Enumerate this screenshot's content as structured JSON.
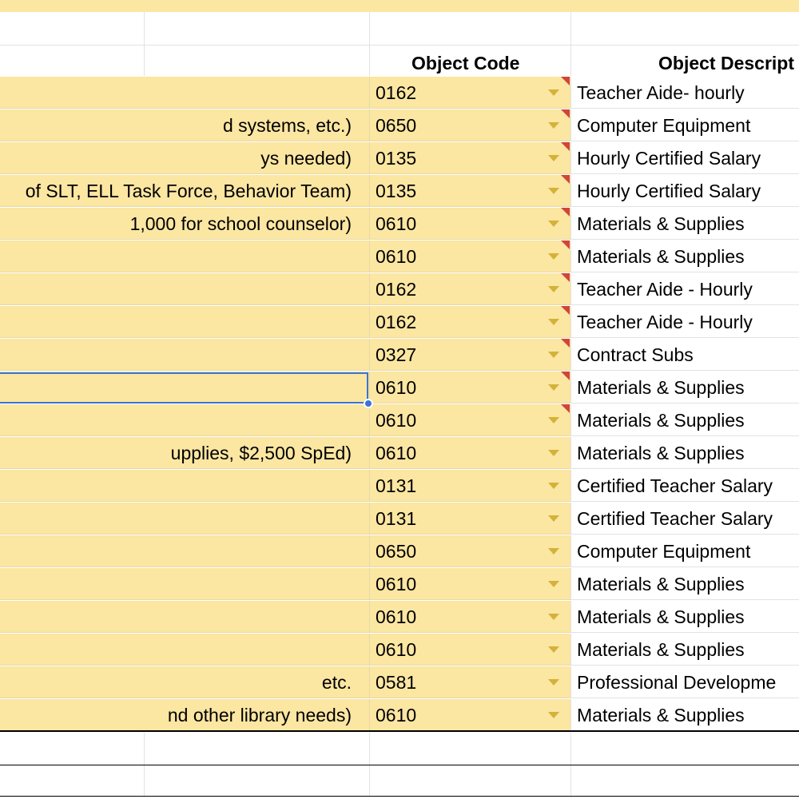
{
  "headers": {
    "object_code": "Object Code",
    "object_description": "Object Descript"
  },
  "rows": [
    {
      "description": "",
      "code": "0162",
      "object_description": "Teacher Aide- hourly",
      "note": true
    },
    {
      "description": "d systems, etc.)",
      "code": "0650",
      "object_description": "Computer Equipment",
      "note": true
    },
    {
      "description": "ys needed)",
      "code": "0135",
      "object_description": "Hourly Certified Salary",
      "note": true
    },
    {
      "description": "of SLT, ELL Task Force, Behavior Team)",
      "code": "0135",
      "object_description": "Hourly Certified Salary",
      "note": true
    },
    {
      "description": "1,000 for school counselor)",
      "code": "0610",
      "object_description": "Materials & Supplies",
      "note": true
    },
    {
      "description": "",
      "code": "0610",
      "object_description": "Materials & Supplies",
      "note": true
    },
    {
      "description": "",
      "code": "0162",
      "object_description": "Teacher Aide - Hourly",
      "note": true
    },
    {
      "description": "",
      "code": "0162",
      "object_description": "Teacher Aide - Hourly",
      "note": true
    },
    {
      "description": "",
      "code": "0327",
      "object_description": "Contract Subs",
      "note": true
    },
    {
      "description": "",
      "code": "0610",
      "object_description": "Materials & Supplies",
      "note": true
    },
    {
      "description": "",
      "code": "0610",
      "object_description": "Materials & Supplies",
      "note": true
    },
    {
      "description": "upplies, $2,500 SpEd)",
      "code": "0610",
      "object_description": "Materials & Supplies",
      "note": false
    },
    {
      "description": "",
      "code": "0131",
      "object_description": "Certified Teacher Salary",
      "note": false
    },
    {
      "description": "",
      "code": "0131",
      "object_description": "Certified Teacher Salary",
      "note": false
    },
    {
      "description": "",
      "code": "0650",
      "object_description": "Computer Equipment",
      "note": false
    },
    {
      "description": "",
      "code": "0610",
      "object_description": "Materials & Supplies",
      "note": false
    },
    {
      "description": "",
      "code": "0610",
      "object_description": "Materials & Supplies",
      "note": false
    },
    {
      "description": "",
      "code": "0610",
      "object_description": "Materials & Supplies",
      "note": false
    },
    {
      "description": "etc.",
      "code": "0581",
      "object_description": "Professional Developme",
      "note": false
    },
    {
      "description": "nd other library needs)",
      "code": "0610",
      "object_description": "Materials & Supplies",
      "note": false
    }
  ],
  "colors": {
    "highlight_fill": "#fbe6a2",
    "selection_border": "#3b73d6",
    "note_flag": "#d0453a",
    "dropdown_arrow": "#d4b23a"
  }
}
